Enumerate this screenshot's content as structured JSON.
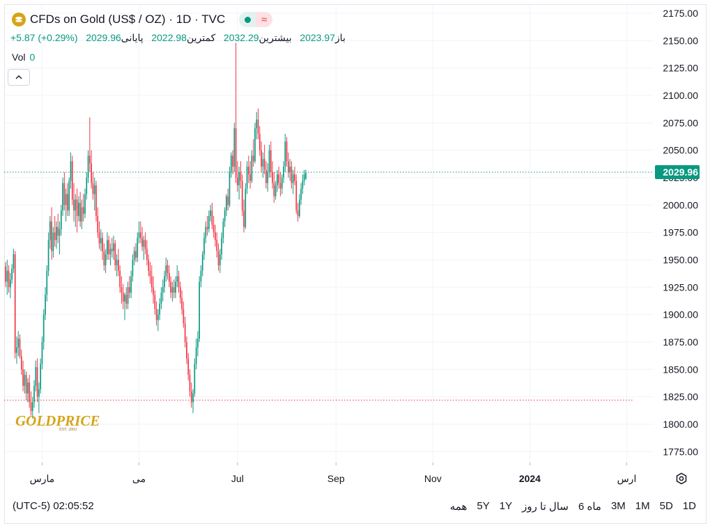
{
  "header": {
    "title": "CFDs on Gold (US$ / OZ) · 1D · TVC",
    "ohlc": {
      "open_label": "باز",
      "open": "2023.97",
      "high_label": "بیشترین",
      "high": "2032.29",
      "low_label": "کمترین",
      "low": "2022.98",
      "close_label": "پایانی",
      "close": "2029.96",
      "change": "+5.87 (+0.29%)"
    },
    "vol_label": "Vol",
    "vol_value": "0"
  },
  "watermark": {
    "text": "GOLDPRICE",
    "sub": "EST. 2002"
  },
  "toolbar": {
    "timezone_clock": "(UTC-5) 02:05:52",
    "ranges": [
      "1D",
      "5D",
      "1M",
      "3M",
      "6 ماه",
      "سال تا روز",
      "1Y",
      "5Y",
      "همه"
    ]
  },
  "colors": {
    "up": "#089981",
    "down": "#f23645",
    "text": "#131722",
    "grid": "#f0f3fa",
    "gold": "#d6a419"
  },
  "chart_data": {
    "type": "candlestick",
    "title": "CFDs on Gold (US$ / OZ) · 1D · TVC",
    "ylim": [
      1765,
      2182
    ],
    "yticks": [
      1775,
      1800,
      1825,
      1850,
      1875,
      1900,
      1925,
      1950,
      1975,
      2000,
      2025,
      2050,
      2075,
      2100,
      2125,
      2150,
      2175
    ],
    "ytick_labels": [
      "1775.00",
      "1800.00",
      "1825.00",
      "1850.00",
      "1875.00",
      "1900.00",
      "1925.00",
      "1950.00",
      "1975.00",
      "2000.00",
      "2025.00",
      "2050.00",
      "2075.00",
      "2100.00",
      "2125.00",
      "2150.00",
      "2175.00"
    ],
    "x_tick_labels": [
      {
        "label": "مارس",
        "day": 23,
        "bold": false
      },
      {
        "label": "می",
        "day": 84,
        "bold": false
      },
      {
        "label": "Jul",
        "day": 146,
        "bold": false
      },
      {
        "label": "Sep",
        "day": 208,
        "bold": false
      },
      {
        "label": "Nov",
        "day": 269,
        "bold": false
      },
      {
        "label": "2024",
        "day": 330,
        "bold": true
      },
      {
        "label": "ارس",
        "day": 391,
        "bold": false
      }
    ],
    "last_price": 2029.96,
    "last_price_label": "2029.96",
    "reference_low": 1822,
    "x_unit": "trading day index (day 0 = first candle at left edge, ~mid-Feb 2023)",
    "candles": [
      [
        1944,
        1948,
        1925,
        1930
      ],
      [
        1930,
        1950,
        1918,
        1940
      ],
      [
        1940,
        1945,
        1920,
        1925
      ],
      [
        1925,
        1938,
        1915,
        1932
      ],
      [
        1932,
        1946,
        1928,
        1942
      ],
      [
        1942,
        1960,
        1938,
        1955
      ],
      [
        1955,
        1958,
        1860,
        1865
      ],
      [
        1865,
        1880,
        1855,
        1870
      ],
      [
        1870,
        1885,
        1862,
        1878
      ],
      [
        1878,
        1882,
        1860,
        1862
      ],
      [
        1862,
        1868,
        1845,
        1850
      ],
      [
        1850,
        1858,
        1830,
        1835
      ],
      [
        1835,
        1850,
        1828,
        1845
      ],
      [
        1845,
        1848,
        1822,
        1828
      ],
      [
        1828,
        1842,
        1820,
        1838
      ],
      [
        1838,
        1845,
        1815,
        1820
      ],
      [
        1820,
        1830,
        1808,
        1812
      ],
      [
        1812,
        1825,
        1805,
        1820
      ],
      [
        1820,
        1840,
        1815,
        1835
      ],
      [
        1835,
        1858,
        1830,
        1852
      ],
      [
        1852,
        1860,
        1820,
        1825
      ],
      [
        1825,
        1838,
        1810,
        1832
      ],
      [
        1832,
        1860,
        1828,
        1855
      ],
      [
        1855,
        1880,
        1850,
        1875
      ],
      [
        1875,
        1905,
        1868,
        1900
      ],
      [
        1900,
        1925,
        1895,
        1918
      ],
      [
        1918,
        1945,
        1912,
        1940
      ],
      [
        1940,
        1975,
        1935,
        1968
      ],
      [
        1968,
        1990,
        1960,
        1985
      ],
      [
        1985,
        1998,
        1950,
        1958
      ],
      [
        1958,
        1980,
        1952,
        1975
      ],
      [
        1975,
        1990,
        1962,
        1968
      ],
      [
        1968,
        1985,
        1960,
        1980
      ],
      [
        1980,
        1992,
        1965,
        1972
      ],
      [
        1972,
        1985,
        1955,
        1978
      ],
      [
        1978,
        2000,
        1972,
        1995
      ],
      [
        1995,
        2025,
        1990,
        2020
      ],
      [
        2020,
        2030,
        1995,
        2000
      ],
      [
        2000,
        2015,
        1985,
        2010
      ],
      [
        2010,
        2020,
        1990,
        1995
      ],
      [
        1995,
        2025,
        1990,
        2022
      ],
      [
        2022,
        2048,
        2015,
        2040
      ],
      [
        2040,
        2045,
        2000,
        2005
      ],
      [
        2005,
        2020,
        1985,
        1995
      ],
      [
        1995,
        2010,
        1980,
        2005
      ],
      [
        2005,
        2015,
        1975,
        1990
      ],
      [
        1990,
        2008,
        1985,
        2002
      ],
      [
        2002,
        2012,
        1980,
        1985
      ],
      [
        1985,
        2005,
        1978,
        1998
      ],
      [
        1998,
        2010,
        1985,
        1992
      ],
      [
        1992,
        2015,
        1988,
        2010
      ],
      [
        2010,
        2030,
        2005,
        2025
      ],
      [
        2025,
        2050,
        2020,
        2045
      ],
      [
        2045,
        2080,
        2030,
        2038
      ],
      [
        2038,
        2050,
        2015,
        2020
      ],
      [
        2020,
        2030,
        2005,
        2010
      ],
      [
        2010,
        2025,
        1995,
        2018
      ],
      [
        2018,
        2022,
        1985,
        1990
      ],
      [
        1990,
        1998,
        1970,
        1975
      ],
      [
        1975,
        1985,
        1960,
        1965
      ],
      [
        1965,
        1978,
        1958,
        1970
      ],
      [
        1970,
        1975,
        1950,
        1958
      ],
      [
        1958,
        1965,
        1940,
        1945
      ],
      [
        1945,
        1960,
        1938,
        1955
      ],
      [
        1955,
        1975,
        1950,
        1968
      ],
      [
        1968,
        1972,
        1950,
        1955
      ],
      [
        1955,
        1965,
        1945,
        1960
      ],
      [
        1960,
        1970,
        1952,
        1958
      ],
      [
        1958,
        1972,
        1950,
        1965
      ],
      [
        1965,
        1968,
        1940,
        1945
      ],
      [
        1945,
        1955,
        1935,
        1950
      ],
      [
        1950,
        1960,
        1935,
        1940
      ],
      [
        1940,
        1945,
        1920,
        1925
      ],
      [
        1925,
        1935,
        1910,
        1920
      ],
      [
        1920,
        1928,
        1905,
        1912
      ],
      [
        1912,
        1920,
        1895,
        1918
      ],
      [
        1918,
        1925,
        1905,
        1910
      ],
      [
        1910,
        1930,
        1905,
        1925
      ],
      [
        1925,
        1935,
        1915,
        1920
      ],
      [
        1920,
        1940,
        1915,
        1935
      ],
      [
        1935,
        1955,
        1930,
        1950
      ],
      [
        1950,
        1962,
        1945,
        1958
      ],
      [
        1958,
        1965,
        1948,
        1952
      ],
      [
        1952,
        1975,
        1948,
        1970
      ],
      [
        1970,
        1985,
        1965,
        1975
      ],
      [
        1975,
        1985,
        1965,
        1970
      ],
      [
        1970,
        1980,
        1958,
        1962
      ],
      [
        1962,
        1972,
        1950,
        1968
      ],
      [
        1968,
        1975,
        1955,
        1960
      ],
      [
        1960,
        1968,
        1945,
        1950
      ],
      [
        1950,
        1955,
        1935,
        1940
      ],
      [
        1940,
        1948,
        1928,
        1935
      ],
      [
        1935,
        1945,
        1920,
        1925
      ],
      [
        1925,
        1935,
        1910,
        1918
      ],
      [
        1918,
        1922,
        1900,
        1905
      ],
      [
        1905,
        1912,
        1890,
        1895
      ],
      [
        1895,
        1905,
        1885,
        1900
      ],
      [
        1900,
        1915,
        1895,
        1910
      ],
      [
        1910,
        1925,
        1905,
        1920
      ],
      [
        1920,
        1932,
        1912,
        1925
      ],
      [
        1925,
        1940,
        1920,
        1935
      ],
      [
        1935,
        1952,
        1930,
        1945
      ],
      [
        1945,
        1950,
        1932,
        1938
      ],
      [
        1938,
        1945,
        1925,
        1930
      ],
      [
        1930,
        1935,
        1915,
        1920
      ],
      [
        1920,
        1930,
        1912,
        1925
      ],
      [
        1925,
        1932,
        1915,
        1920
      ],
      [
        1920,
        1935,
        1915,
        1930
      ],
      [
        1930,
        1945,
        1925,
        1935
      ],
      [
        1935,
        1940,
        1920,
        1925
      ],
      [
        1925,
        1930,
        1910,
        1915
      ],
      [
        1915,
        1922,
        1900,
        1905
      ],
      [
        1905,
        1912,
        1888,
        1892
      ],
      [
        1892,
        1898,
        1870,
        1875
      ],
      [
        1875,
        1880,
        1855,
        1860
      ],
      [
        1860,
        1865,
        1840,
        1845
      ],
      [
        1845,
        1850,
        1825,
        1830
      ],
      [
        1830,
        1838,
        1815,
        1820
      ],
      [
        1820,
        1832,
        1810,
        1828
      ],
      [
        1828,
        1860,
        1825,
        1855
      ],
      [
        1855,
        1878,
        1850,
        1870
      ],
      [
        1870,
        1885,
        1862,
        1878
      ],
      [
        1878,
        1935,
        1875,
        1930
      ],
      [
        1930,
        1945,
        1925,
        1940
      ],
      [
        1940,
        1958,
        1935,
        1955
      ],
      [
        1955,
        1975,
        1950,
        1970
      ],
      [
        1970,
        1985,
        1965,
        1980
      ],
      [
        1980,
        1990,
        1972,
        1978
      ],
      [
        1978,
        1995,
        1975,
        1990
      ],
      [
        1990,
        2000,
        1985,
        1995
      ],
      [
        1995,
        2002,
        1978,
        1982
      ],
      [
        1982,
        1990,
        1970,
        1975
      ],
      [
        1975,
        1982,
        1962,
        1968
      ],
      [
        1968,
        1975,
        1952,
        1958
      ],
      [
        1958,
        1965,
        1940,
        1945
      ],
      [
        1945,
        1960,
        1938,
        1955
      ],
      [
        1955,
        1975,
        1950,
        1970
      ],
      [
        1970,
        1988,
        1965,
        1985
      ],
      [
        1985,
        1998,
        1980,
        1995
      ],
      [
        1995,
        2010,
        1990,
        2008
      ],
      [
        2008,
        2015,
        1995,
        2000
      ],
      [
        2000,
        2035,
        1998,
        2030
      ],
      [
        2030,
        2048,
        2025,
        2045
      ],
      [
        2045,
        2050,
        2028,
        2035
      ],
      [
        2035,
        2075,
        2030,
        2070
      ],
      [
        2070,
        2148,
        2020,
        2025
      ],
      [
        2025,
        2040,
        2012,
        2018
      ],
      [
        2018,
        2035,
        2005,
        2030
      ],
      [
        2030,
        2040,
        2015,
        2022
      ],
      [
        2022,
        2028,
        1990,
        1995
      ],
      [
        1995,
        2005,
        1975,
        1980
      ],
      [
        1980,
        2020,
        1978,
        2015
      ],
      [
        2015,
        2040,
        2010,
        2035
      ],
      [
        2035,
        2045,
        2020,
        2028
      ],
      [
        2028,
        2040,
        2015,
        2022
      ],
      [
        2022,
        2050,
        2020,
        2045
      ],
      [
        2045,
        2060,
        2035,
        2040
      ],
      [
        2040,
        2075,
        2038,
        2070
      ],
      [
        2070,
        2085,
        2060,
        2078
      ],
      [
        2078,
        2088,
        2060,
        2065
      ],
      [
        2065,
        2072,
        2045,
        2050
      ],
      [
        2050,
        2058,
        2030,
        2035
      ],
      [
        2035,
        2048,
        2025,
        2042
      ],
      [
        2042,
        2055,
        2028,
        2032
      ],
      [
        2032,
        2040,
        2015,
        2020
      ],
      [
        2020,
        2038,
        2012,
        2030
      ],
      [
        2030,
        2055,
        2025,
        2050
      ],
      [
        2050,
        2058,
        2025,
        2030
      ],
      [
        2030,
        2040,
        2015,
        2020
      ],
      [
        2020,
        2030,
        2002,
        2008
      ],
      [
        2008,
        2022,
        2005,
        2018
      ],
      [
        2018,
        2032,
        2012,
        2028
      ],
      [
        2028,
        2035,
        2015,
        2020
      ],
      [
        2020,
        2030,
        2008,
        2015
      ],
      [
        2015,
        2028,
        2010,
        2025
      ],
      [
        2025,
        2040,
        2020,
        2035
      ],
      [
        2035,
        2065,
        2030,
        2058
      ],
      [
        2058,
        2062,
        2035,
        2040
      ],
      [
        2040,
        2048,
        2025,
        2030
      ],
      [
        2030,
        2042,
        2022,
        2035
      ],
      [
        2035,
        2040,
        2015,
        2020
      ],
      [
        2020,
        2032,
        2010,
        2028
      ],
      [
        2028,
        2035,
        2018,
        2022
      ],
      [
        2022,
        2028,
        1992,
        1995
      ],
      [
        1995,
        2002,
        1985,
        1990
      ],
      [
        1990,
        2010,
        1988,
        2005
      ],
      [
        2005,
        2020,
        2000,
        2015
      ],
      [
        2015,
        2028,
        2010,
        2022
      ],
      [
        2022,
        2032,
        2018,
        2028
      ],
      [
        2023.97,
        2032.29,
        2022.98,
        2029.96
      ]
    ],
    "grid": true,
    "legend": "none"
  }
}
